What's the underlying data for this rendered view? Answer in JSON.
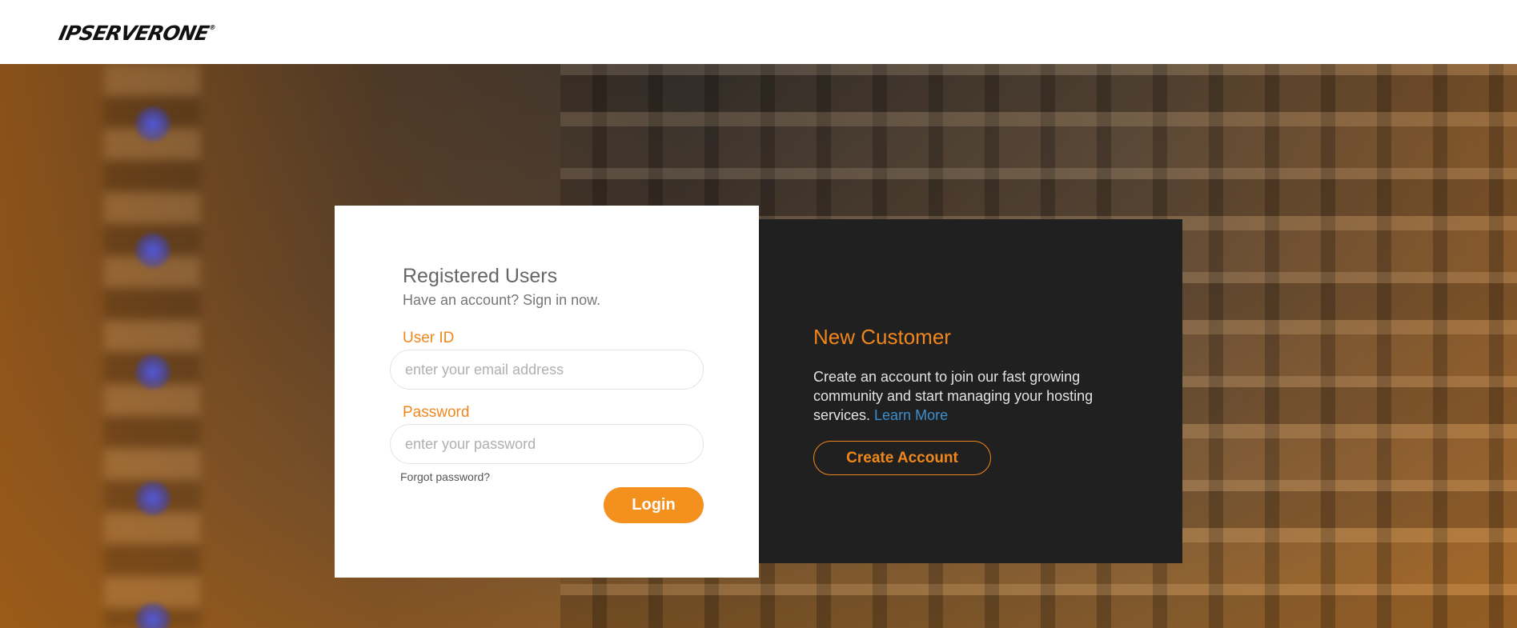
{
  "header": {
    "logo_text": "IPSERVERONE",
    "logo_mark": "®"
  },
  "login": {
    "title": "Registered Users",
    "subtitle": "Have an account? Sign in now.",
    "user_label": "User ID",
    "user_placeholder": "enter your email address",
    "password_label": "Password",
    "password_placeholder": "enter your password",
    "forgot_label": "Forgot password?",
    "login_button": "Login"
  },
  "new_customer": {
    "title": "New Customer",
    "description": "Create an account to join our fast growing community and start managing your hosting services.",
    "learn_more": "Learn More",
    "create_button": "Create Account"
  },
  "colors": {
    "accent": "#f4901e",
    "link": "#3b8fd0",
    "dark_panel": "#202020"
  }
}
